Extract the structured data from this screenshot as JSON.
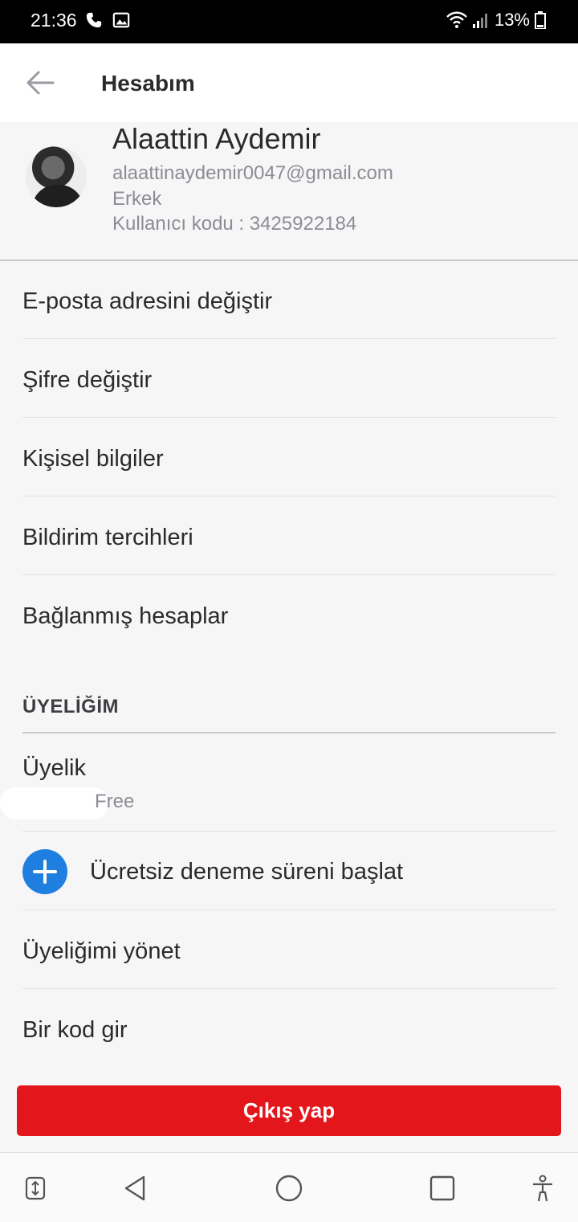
{
  "status_bar": {
    "time": "21:36",
    "battery": "13%",
    "icons": [
      "phone-icon",
      "image-icon",
      "wifi-icon",
      "signal-icon",
      "battery-icon"
    ]
  },
  "header": {
    "title": "Hesabım",
    "back_icon": "back-arrow-icon"
  },
  "profile": {
    "name": "Alaattin Aydemir",
    "email": "alaattinaydemir0047@gmail.com",
    "gender": "Erkek",
    "user_code": "Kullanıcı kodu : 3425922184"
  },
  "account_menu": [
    {
      "label": "E-posta adresini değiştir"
    },
    {
      "label": "Şifre değiştir"
    },
    {
      "label": "Kişisel bilgiler"
    },
    {
      "label": "Bildirim tercihleri"
    },
    {
      "label": "Bağlanmış hesaplar"
    }
  ],
  "membership_section": {
    "header": "ÜYELİĞİM",
    "membership_label": "Üyelik",
    "membership_value": "Free",
    "trial_label": "Ücretsiz deneme süreni başlat",
    "manage_label": "Üyeliğimi yönet",
    "code_label": "Bir kod gir"
  },
  "logout_label": "Çıkış yap",
  "nav_bar": [
    "rotate-icon",
    "back-triangle-icon",
    "home-circle-icon",
    "recents-square-icon",
    "accessibility-icon"
  ],
  "colors": {
    "accent_red": "#e3161b",
    "accent_blue": "#1f7fe0"
  }
}
